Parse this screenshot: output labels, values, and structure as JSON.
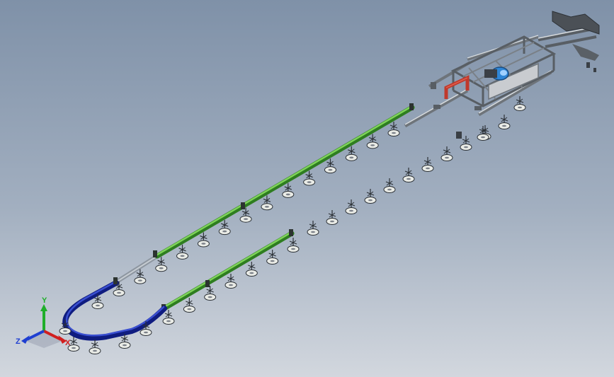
{
  "scene": {
    "description_free": true,
    "colors": {
      "background_top": "#7f91a8",
      "background_bottom": "#d2d7de",
      "rail_green": "#3f8f2c",
      "rail_green_light": "#6cc24a",
      "rail_blue": "#16279a",
      "rail_blue_light": "#3448c8",
      "rail_gray": "#9aa3ad",
      "frame_gray": "#c9ccd0",
      "frame_red": "#c0392b",
      "motor_blue": "#2f86d6"
    }
  },
  "triad": {
    "x_label": "X",
    "y_label": "Y",
    "z_label": "Z",
    "x_color": "#d11f1f",
    "y_color": "#1fae2a",
    "z_color": "#1f3fd1"
  }
}
